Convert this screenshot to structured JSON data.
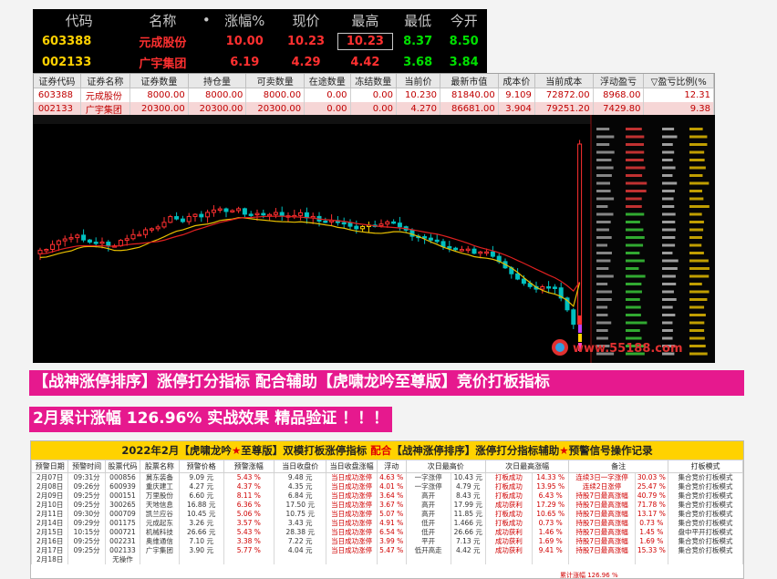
{
  "quote": {
    "headers": [
      "代码",
      "名称",
      "•",
      "涨幅%",
      "现价",
      "最高",
      "最低",
      "今开"
    ],
    "rows": [
      {
        "code": "603388",
        "name": "元成股份",
        "pct": "10.00",
        "price": "10.23",
        "high": "10.23",
        "low": "8.37",
        "open": "8.50"
      },
      {
        "code": "002133",
        "name": "广宇集团",
        "pct": "6.19",
        "price": "4.29",
        "high": "4.42",
        "low": "3.68",
        "open": "3.84"
      }
    ]
  },
  "positions": {
    "headers": [
      "证券代码",
      "证券名称",
      "证券数量",
      "持仓量",
      "可卖数量",
      "在途数量",
      "冻结数量",
      "当前价",
      "最新市值",
      "成本价",
      "当前成本",
      "浮动盈亏",
      "▽盈亏比例(%"
    ],
    "rows": [
      [
        "603388",
        "元成股份",
        "8000.00",
        "8000.00",
        "8000.00",
        "0.00",
        "0.00",
        "10.230",
        "81840.00",
        "9.109",
        "72872.00",
        "8968.00",
        "12.31"
      ],
      [
        "002133",
        "广宇集团",
        "20300.00",
        "20300.00",
        "20300.00",
        "0.00",
        "0.00",
        "4.270",
        "86681.00",
        "3.904",
        "79251.20",
        "7429.80",
        "9.38"
      ]
    ]
  },
  "chart": {
    "watermark": "www.55188.com",
    "colors": {
      "up": "#ff3030",
      "down": "#00c0c0",
      "ma1": "#e8c000",
      "ma2": "#e02020",
      "hl": "#ffd200"
    }
  },
  "banners": {
    "line1": "【战神涨停排序】涨停打分指标 配合辅助【虎啸龙吟至尊版】竞价打板指标",
    "line2": "2月累计涨幅 126.96% 实战效果 精品验证 ！！！"
  },
  "record": {
    "title_a": "2022年2月【虎啸龙吟",
    "title_star": "★",
    "title_b": "至尊版】双模打板涨停指标 ",
    "title_hl": "配合",
    "title_c": "【战神涨停排序】涨停打分指标辅助",
    "title_d": "预警信号操作记录",
    "headers": [
      "预警日期",
      "预警时间",
      "股票代码",
      "股票名称",
      "预警价格",
      "预警涨幅",
      "当日收盘价",
      "当日收盘涨幅",
      "浮动",
      "次日最高价",
      "次日最高涨幅",
      "备注",
      "打板模式"
    ],
    "rows": [
      [
        "2月07日",
        "09:31分",
        "000856",
        "冀东装备",
        "9.09 元",
        "5.43 %",
        "9.48 元",
        "当日成功涨停",
        "4.63 %",
        "一字涨停",
        "10.43 元",
        "打板成功",
        "14.33 %",
        "连续3日一字涨停",
        "30.03 %",
        "集合竞价打板模式"
      ],
      [
        "2月08日",
        "09:26分",
        "600939",
        "重庆建工",
        "4.27 元",
        "4.37 %",
        "4.35 元",
        "当日成功涨停",
        "4.01 %",
        "一字涨停",
        "4.79 元",
        "打板成功",
        "13.95 %",
        "连续2日涨停",
        "25.47 %",
        "集合竞价打板模式"
      ],
      [
        "2月09日",
        "09:25分",
        "000151",
        "万里股份",
        "6.60 元",
        "8.11 %",
        "6.84 元",
        "当日成功涨停",
        "3.64 %",
        "高开",
        "8.43 元",
        "打板成功",
        "6.43 %",
        "持股7日最高涨幅",
        "40.79 %",
        "集合竞价打板模式"
      ],
      [
        "2月10日",
        "09:25分",
        "300265",
        "天地信息",
        "16.88 元",
        "6.36 %",
        "17.50 元",
        "当日成功涨停",
        "3.67 %",
        "高开",
        "17.99 元",
        "成功获利",
        "17.29 %",
        "持股7日最高涨幅",
        "71.78 %",
        "集合竞价打板模式"
      ],
      [
        "2月11日",
        "09:30分",
        "000709",
        "凯兰应谷",
        "10.45 元",
        "5.06 %",
        "10.75 元",
        "当日成功涨停",
        "5.07 %",
        "高开",
        "11.85 元",
        "打板成功",
        "10.65 %",
        "持股7日最高涨幅",
        "13.17 %",
        "集合竞价打板模式"
      ],
      [
        "2月14日",
        "09:29分",
        "001175",
        "元成起东",
        "3.26 元",
        "3.57 %",
        "3.43 元",
        "当日成功涨停",
        "4.91 %",
        "低开",
        "1.466 元",
        "打板成功",
        "0.73 %",
        "持股7日最高涨幅",
        "0.73 %",
        "集合竞价打板模式"
      ],
      [
        "2月15日",
        "10:15分",
        "000721",
        "机械科技",
        "26.66 元",
        "5.43 %",
        "28.38 元",
        "当日成功涨停",
        "6.54 %",
        "低开",
        "26.66 元",
        "成功获利",
        "1.46 %",
        "持股7日最高涨幅",
        "1.45 %",
        "盘中平开打板模式"
      ],
      [
        "2月16日",
        "09:25分",
        "002231",
        "奥维通信",
        "7.10 元",
        "3.38 %",
        "7.22 元",
        "当日成功涨停",
        "3.99 %",
        "平开",
        "7.13 元",
        "成功获利",
        "1.69 %",
        "持股7日最高涨幅",
        "1.69 %",
        "集合竞价打板模式"
      ],
      [
        "2月17日",
        "09:25分",
        "002133",
        "广宇集团",
        "3.90 元",
        "5.77 %",
        "4.04 元",
        "当日成功涨停",
        "5.47 %",
        "低开高走",
        "4.42 元",
        "成功获利",
        "9.41 %",
        "持股7日最高涨幅",
        "15.33 %",
        "集合竞价打板模式"
      ],
      [
        "2月18日",
        "",
        "无操作",
        "",
        "",
        "",
        "",
        "",
        "",
        "",
        "",
        "",
        "",
        "",
        "",
        ""
      ]
    ],
    "footer_note": "【战神涨停排序】涨停打分辅助 核心",
    "total": "累计涨幅 126.96 %"
  }
}
